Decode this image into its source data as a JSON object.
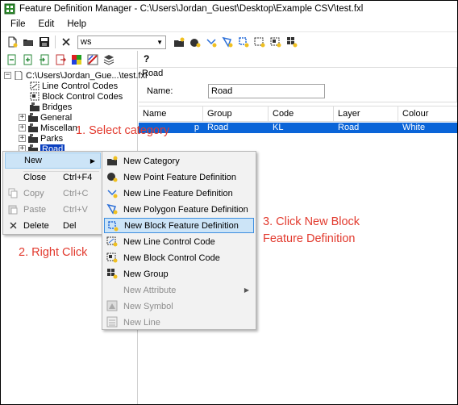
{
  "window": {
    "title": "Feature Definition Manager - C:\\Users\\Jordan_Guest\\Desktop\\Example CSV\\test.fxl"
  },
  "menubar": [
    "File",
    "Edit",
    "Help"
  ],
  "toolbar": {
    "workspace_value": "ws"
  },
  "help_button": "?",
  "tree": {
    "root": "C:\\Users\\Jordan_Gue...\\test.fxl",
    "items": [
      {
        "label": "Line Control Codes",
        "expander": ""
      },
      {
        "label": "Block Control Codes",
        "expander": ""
      },
      {
        "label": "Bridges",
        "expander": ""
      },
      {
        "label": "General",
        "expander": "+"
      },
      {
        "label": "Miscellan",
        "expander": "+"
      },
      {
        "label": "Parks",
        "expander": "+"
      },
      {
        "label": "Road",
        "expander": "+"
      }
    ]
  },
  "detail": {
    "group_label": "Road",
    "name_label": "Name:",
    "name_value": "Road"
  },
  "grid": {
    "columns": [
      "Name",
      "Group",
      "Code",
      "Layer",
      "Colour"
    ],
    "row": {
      "name": "p",
      "group": "Road",
      "code": "KL",
      "layer": "Road",
      "colour": "White"
    }
  },
  "context_menu": {
    "new": "New",
    "close": "Close",
    "close_shortcut": "Ctrl+F4",
    "copy": "Copy",
    "copy_shortcut": "Ctrl+C",
    "paste": "Paste",
    "paste_shortcut": "Ctrl+V",
    "delete": "Delete",
    "delete_shortcut": "Del"
  },
  "submenu": [
    "New Category",
    "New Point Feature Definition",
    "New Line Feature Definition",
    "New Polygon Feature Definition",
    "New Block Feature Definition",
    "New Line Control Code",
    "New Block Control Code",
    "New Group",
    "New Attribute",
    "New Symbol",
    "New Line"
  ],
  "annotations": {
    "step1": "1. Select category",
    "step2": "2. Right Click",
    "step3_line1": "3. Click New Block",
    "step3_line2": "Feature Definition"
  },
  "colors": {
    "annotation": "#e23a2e",
    "selection": "#0a64d8",
    "menu_highlight": "#cce4f7"
  }
}
